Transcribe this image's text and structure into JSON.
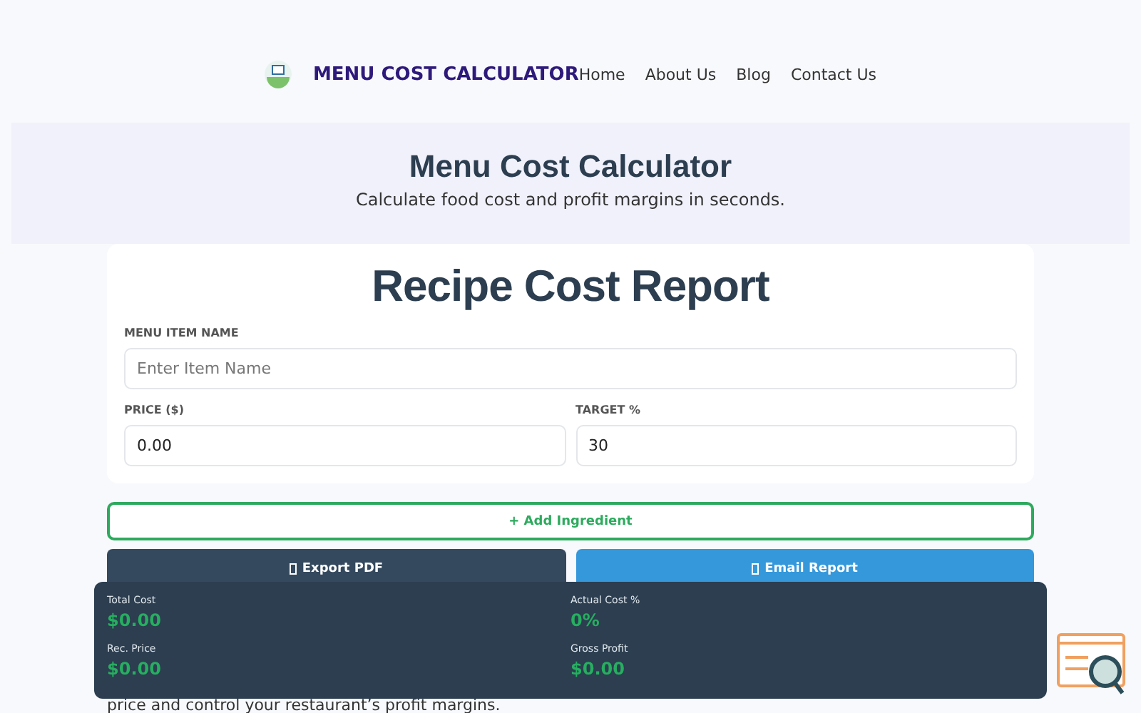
{
  "header": {
    "brand": "MENU COST CALCULATOR",
    "nav": [
      {
        "label": "Home"
      },
      {
        "label": "About Us"
      },
      {
        "label": "Blog"
      },
      {
        "label": "Contact Us"
      }
    ]
  },
  "hero": {
    "title": "Menu Cost Calculator",
    "subtitle": "Calculate food cost and profit margins in seconds."
  },
  "report": {
    "title": "Recipe Cost Report",
    "item_name": {
      "label": "MENU ITEM NAME",
      "placeholder": "Enter Item Name"
    },
    "price": {
      "label": "PRICE ($)",
      "value": "0.00"
    },
    "target": {
      "label": "TARGET %",
      "value": "30"
    }
  },
  "add_button": "+ Add Ingredient",
  "actions": [
    {
      "label": "Export PDF",
      "kind": "dark"
    },
    {
      "label": "Email Report",
      "kind": "blue"
    }
  ],
  "summary": [
    {
      "label": "Total Cost",
      "value": "$0.00"
    },
    {
      "label": "Actual Cost %",
      "value": "0%"
    },
    {
      "label": "Rec. Price",
      "value": "$0.00"
    },
    {
      "label": "Gross Profit",
      "value": "$0.00"
    }
  ],
  "footer_text": "price and control your restaurant’s profit margins."
}
